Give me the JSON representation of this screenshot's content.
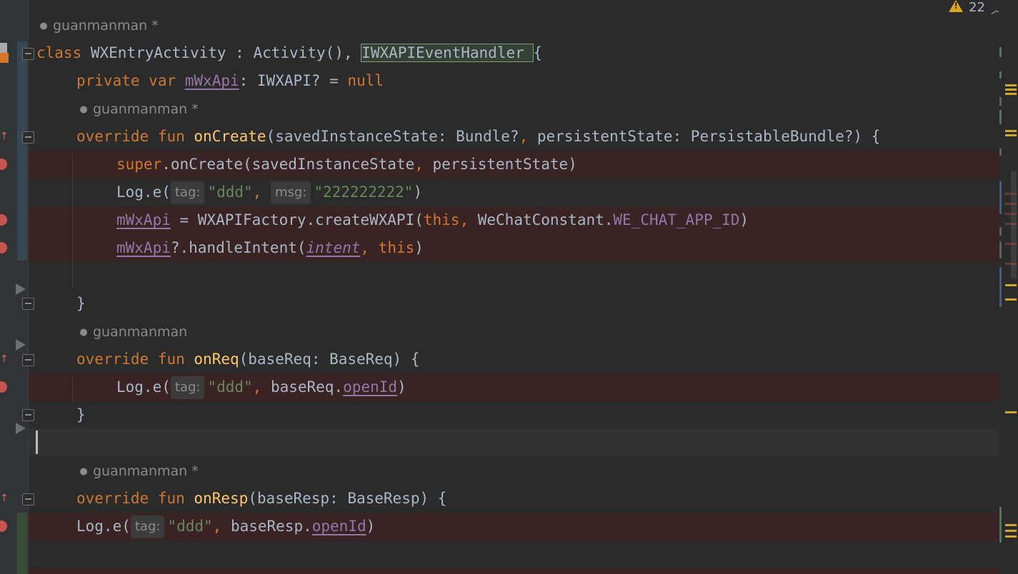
{
  "inspections": {
    "warning_count": "22",
    "warning_icon": "warning-icon",
    "prev_icon": "chevron-up-icon"
  },
  "authors": {
    "a1": "guanmanman *",
    "a2": "guanmanman *",
    "a3": "guanmanman",
    "a4": "guanmanman *"
  },
  "code": {
    "l1": {
      "kw": "class",
      "name": "WXEntryActivity : Activity(), ",
      "iface": "IWXAPIEventHandler ",
      "brace": "{"
    },
    "l2": {
      "kw1": "private",
      "kw2": "var",
      "field": "mWxApi",
      "type": ": IWXAPI? = ",
      "nul": "null"
    },
    "l3": {
      "kw1": "override",
      "kw2": "fun",
      "fn": "onCreate",
      "params1": "(savedInstanceState: Bundle?",
      "comma": ",",
      "params2": " persistentState: PersistableBundle?) {"
    },
    "l4": {
      "kw": "super",
      "call": ".onCreate(savedInstanceState",
      "comma": ",",
      "rest": " persistentState)"
    },
    "l5": {
      "call": "Log.e(",
      "hint_tag": "tag:",
      "str1": "\"ddd\"",
      "comma": ", ",
      "hint_msg": "msg:",
      "str2": "\"222222222\"",
      "close": ")"
    },
    "l6": {
      "field": "mWxApi",
      "mid": " = WXAPIFactory.createWXAPI(",
      "kw": "this",
      "comma": ", ",
      "cls": "WeChatConstant.",
      "const": "WE_CHAT_APP_ID",
      "close": ")"
    },
    "l7": {
      "field": "mWxApi",
      "call": "?.handleIntent(",
      "param": "intent",
      "comma": ", ",
      "kw": "this",
      "close": ")"
    },
    "l8": {
      "brace": "}"
    },
    "l9": {
      "kw1": "override",
      "kw2": "fun",
      "fn": "onReq",
      "params": "(baseReq: BaseReq) {"
    },
    "l10": {
      "call": "Log.e(",
      "hint_tag": "tag:",
      "str1": "\"ddd\"",
      "comma": ", ",
      "obj": "baseReq.",
      "prop": "openId",
      "close": ")"
    },
    "l11": {
      "brace": "}"
    },
    "l12": {
      "kw1": "override",
      "kw2": "fun",
      "fn": "onResp",
      "params": "(baseResp: BaseResp) {"
    },
    "l13": {
      "call": "Log.e(",
      "hint_tag": "tag:",
      "str1": "\"ddd\"",
      "comma": ", ",
      "obj": "baseResp.",
      "prop": "openId",
      "close": ")"
    }
  },
  "colors": {
    "background": "#2b2b2b",
    "keyword": "#cc7832",
    "function": "#ffc66d",
    "string": "#6a8759",
    "property": "#9876aa",
    "breakpoint": "#c75450",
    "breakpoint_line": "#3a2323"
  }
}
